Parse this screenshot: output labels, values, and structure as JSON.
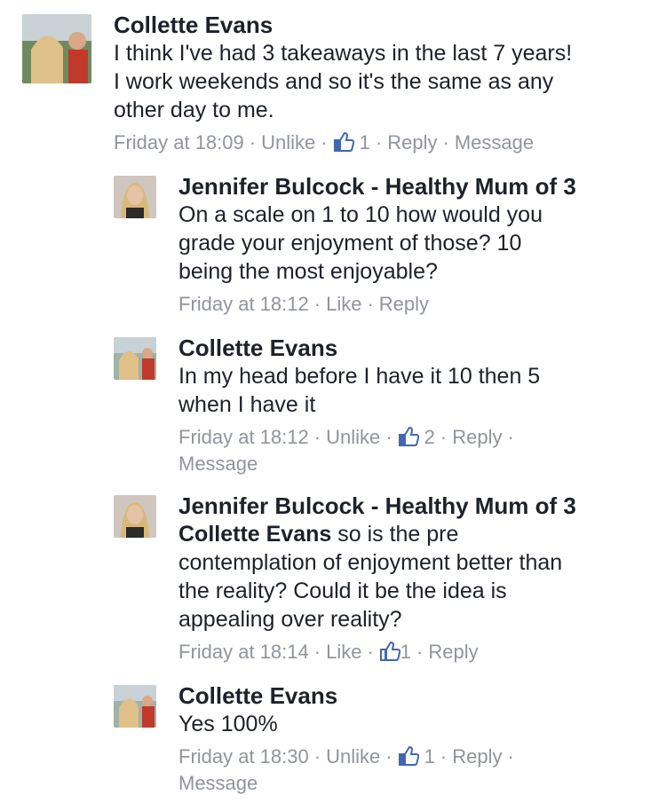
{
  "comments": [
    {
      "author": "Collette Evans",
      "text": "I think I've had 3 takeaways in the last 7 years!\nI work weekends and so it's the same as any\nother day to me.",
      "time": "Friday at 18:09",
      "like_action": "Unlike",
      "like_count": "1",
      "reply": "Reply",
      "message": "Message"
    },
    {
      "author": "Jennifer Bulcock - Healthy Mum of 3",
      "text": "On a scale on 1 to 10 how would you\ngrade your enjoyment of those? 10\nbeing the most enjoyable?",
      "time": "Friday at 18:12",
      "like_action": "Like",
      "reply": "Reply"
    },
    {
      "author": "Collette Evans",
      "text": "In my head before I have it 10 then 5\nwhen I have it",
      "time": "Friday at 18:12",
      "like_action": "Unlike",
      "like_count": "2",
      "reply": "Reply",
      "message": "Message"
    },
    {
      "author": "Jennifer Bulcock - Healthy Mum of 3",
      "mention": "Collette Evans",
      "text": " so is the pre\ncontemplation of enjoyment better than\nthe reality? Could it be the idea is\nappealing over reality?",
      "time": "Friday at 18:14",
      "like_action": "Like",
      "like_count": "1",
      "reply": "Reply"
    },
    {
      "author": "Collette Evans",
      "text": "Yes 100%",
      "time": "Friday at 18:30",
      "like_action": "Unlike",
      "like_count": "1",
      "reply": "Reply",
      "message": "Message"
    }
  ],
  "colors": {
    "link_blue": "#4267b2",
    "meta_gray": "#90949c",
    "text": "#1d2129"
  }
}
